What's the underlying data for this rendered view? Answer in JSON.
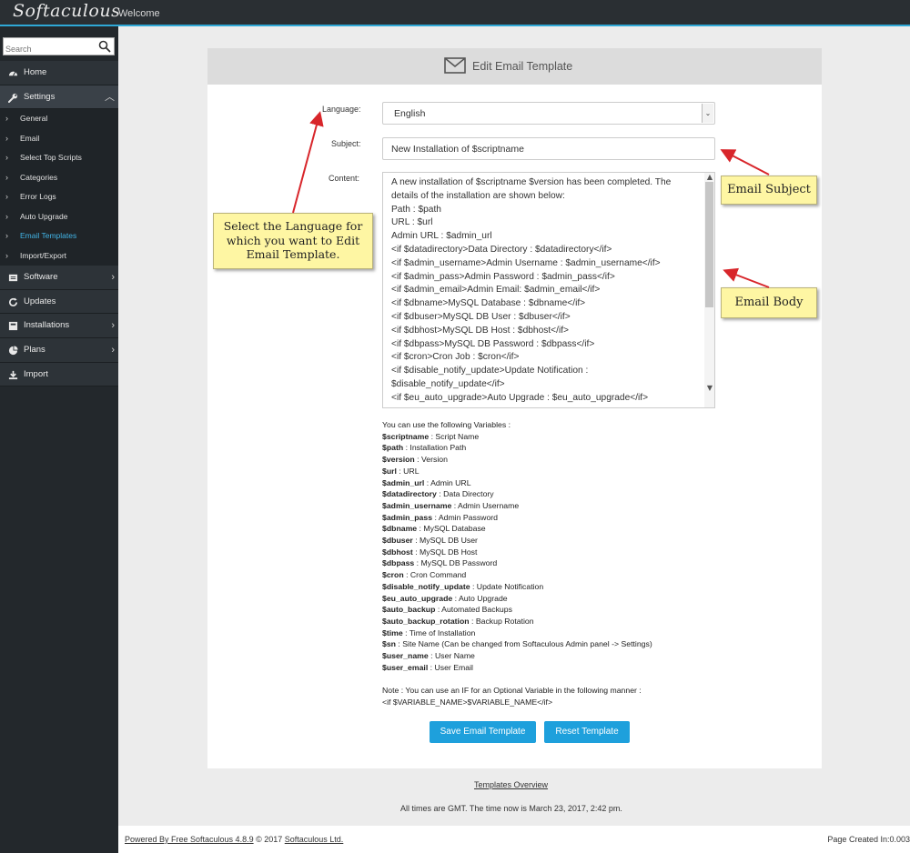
{
  "topbar": {
    "logo": "Softaculous",
    "welcome": "Welcome"
  },
  "sidebar": {
    "search_placeholder": "Search",
    "items": [
      {
        "label": "Home",
        "icon": "dashboard-icon"
      },
      {
        "label": "Settings",
        "icon": "wrench-icon"
      }
    ],
    "settings_sub": [
      "General",
      "Email",
      "Select Top Scripts",
      "Categories",
      "Error Logs",
      "Auto Upgrade",
      "Email Templates",
      "Import/Export"
    ],
    "items2": [
      {
        "label": "Software",
        "icon": "software-icon"
      },
      {
        "label": "Updates",
        "icon": "refresh-icon"
      },
      {
        "label": "Installations",
        "icon": "installations-icon"
      },
      {
        "label": "Plans",
        "icon": "pie-chart-icon"
      },
      {
        "label": "Import",
        "icon": "download-icon"
      }
    ]
  },
  "panel": {
    "title": "Edit Email Template",
    "language_label": "Language:",
    "language_value": "English",
    "subject_label": "Subject:",
    "subject_value": "New Installation of $scriptname",
    "content_label": "Content:",
    "content_lines": [
      "A new installation of $scriptname $version has been completed. The details of the installation are shown below:",
      "Path : $path",
      "URL : $url",
      "Admin URL : $admin_url",
      "<if $datadirectory>Data Directory : $datadirectory</if>",
      "<if $admin_username>Admin Username : $admin_username</if>",
      "<if $admin_pass>Admin Password : $admin_pass</if>",
      "<if $admin_email>Admin Email: $admin_email</if>",
      "<if $dbname>MySQL Database : $dbname</if>",
      "<if $dbuser>MySQL DB User : $dbuser</if>",
      "<if $dbhost>MySQL DB Host : $dbhost</if>",
      "<if $dbpass>MySQL DB Password : $dbpass</if>",
      "<if $cron>Cron Job : $cron</if>",
      "<if $disable_notify_update>Update Notification : $disable_notify_update</if>",
      "<if $eu_auto_upgrade>Auto Upgrade : $eu_auto_upgrade</if>"
    ],
    "vars_title": "You can use the following Variables :",
    "vars": [
      {
        "k": "$scriptname",
        "v": " : Script Name"
      },
      {
        "k": "$path",
        "v": " : Installation Path"
      },
      {
        "k": "$version",
        "v": " : Version"
      },
      {
        "k": "$url",
        "v": " : URL"
      },
      {
        "k": "$admin_url",
        "v": " : Admin URL"
      },
      {
        "k": "$datadirectory",
        "v": " : Data Directory"
      },
      {
        "k": "$admin_username",
        "v": " : Admin Username"
      },
      {
        "k": "$admin_pass",
        "v": " : Admin Password"
      },
      {
        "k": "$dbname",
        "v": " : MySQL Database"
      },
      {
        "k": "$dbuser",
        "v": " : MySQL DB User"
      },
      {
        "k": "$dbhost",
        "v": " : MySQL DB Host"
      },
      {
        "k": "$dbpass",
        "v": " : MySQL DB Password"
      },
      {
        "k": "$cron",
        "v": " : Cron Command"
      },
      {
        "k": "$disable_notify_update",
        "v": " : Update Notification"
      },
      {
        "k": "$eu_auto_upgrade",
        "v": " : Auto Upgrade"
      },
      {
        "k": "$auto_backup",
        "v": " : Automated Backups"
      },
      {
        "k": "$auto_backup_rotation",
        "v": " : Backup Rotation"
      },
      {
        "k": "$time",
        "v": " : Time of Installation"
      },
      {
        "k": "$sn",
        "v": " : Site Name (Can be changed from Softaculous Admin panel -> Settings)"
      },
      {
        "k": "$user_name",
        "v": " : User Name"
      },
      {
        "k": "$user_email",
        "v": " : User Email"
      }
    ],
    "note": "Note : You can use an IF for an Optional Variable in the following manner :",
    "note_example": "<if $VARIABLE_NAME>$VARIABLE_NAME</if>",
    "save_button": "Save Email Template",
    "reset_button": "Reset Template"
  },
  "templates_overview": "Templates Overview",
  "time_note": "All times are GMT. The time now is March 23, 2017, 2:42 pm.",
  "footer": {
    "powered": "Powered By Free Softaculous 4.8.9",
    "copyright": " © 2017 ",
    "company": "Softaculous Ltd.",
    "page_created": "Page Created In:0.003"
  },
  "callouts": {
    "language": "Select the Language for which you want to Edit Email Template.",
    "subject": "Email Subject",
    "body": "Email Body"
  },
  "colors": {
    "accent": "#1ea0dc",
    "sidebar": "#23282c",
    "callout": "#fef6a3",
    "arrow": "#d8262b"
  }
}
